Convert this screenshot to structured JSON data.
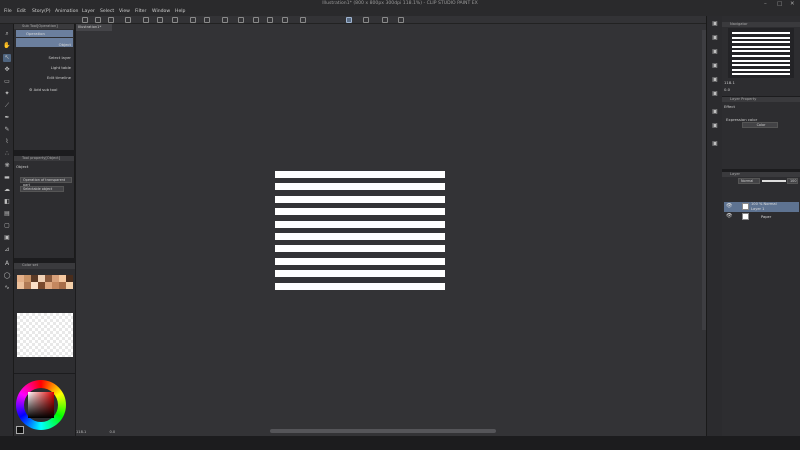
{
  "window": {
    "title": "Illustration1* (800 x 800px 300dpi 118.1%)  - CLIP STUDIO PAINT EX",
    "controls": [
      "–",
      "□",
      "✕"
    ]
  },
  "menu": [
    "File",
    "Edit",
    "Story(P)",
    "Animation",
    "Layer",
    "Select",
    "View",
    "Filter",
    "Window",
    "Help"
  ],
  "sub_tool": {
    "header": "Sub Tool[Operation]",
    "items": [
      {
        "label": "Operation",
        "selected": true
      },
      {
        "label": "Object",
        "selected": true
      },
      {
        "label": "Select layer",
        "selected": false
      },
      {
        "label": "Light table",
        "selected": false
      },
      {
        "label": "Edit timeline",
        "selected": false
      }
    ],
    "add_label": "Add sub tool"
  },
  "tool_property": {
    "header": "Tool property[Object]",
    "title": "Object",
    "field1": "Operation of transparent part",
    "field2": "Selectable object"
  },
  "color_set": {
    "tab1": "Color set",
    "tab2": "Color set",
    "swatches": [
      "#e4b089",
      "#c99367",
      "#5b3a26",
      "#f1d2b6",
      "#8a5a3c",
      "#d7a07a",
      "#f5c8a0",
      "#4a2d1c",
      "#ecc19c",
      "#b07a55",
      "#fbe0c8",
      "#7a4a2e",
      "#e0a982",
      "#c4875f",
      "#a86e4a",
      "#f3cfa9"
    ]
  },
  "canvas": {
    "tab": "Illustration1*",
    "background": "#333336",
    "stripe_count": 10,
    "stripe_color": "#ffffff"
  },
  "status": {
    "zoom": "118.1",
    "angle": "0.0"
  },
  "navigator": {
    "header": "Navigator",
    "zoom": "118.1",
    "angle": "0.0"
  },
  "layer_property": {
    "header": "Layer Property",
    "effect_label": "Effect",
    "expression_label": "Expression color",
    "expression_value": "Color"
  },
  "layer": {
    "header": "Layer",
    "blend_mode": "Normal",
    "opacity": "100",
    "rows": [
      {
        "pct": "100 % Normal",
        "name": "Layer 1",
        "selected": true
      },
      {
        "pct": "",
        "name": "Paper",
        "selected": false
      }
    ]
  },
  "colors": {
    "accent": "#5e7391",
    "panel": "#2d2d30",
    "canvas_bg": "#333336"
  }
}
